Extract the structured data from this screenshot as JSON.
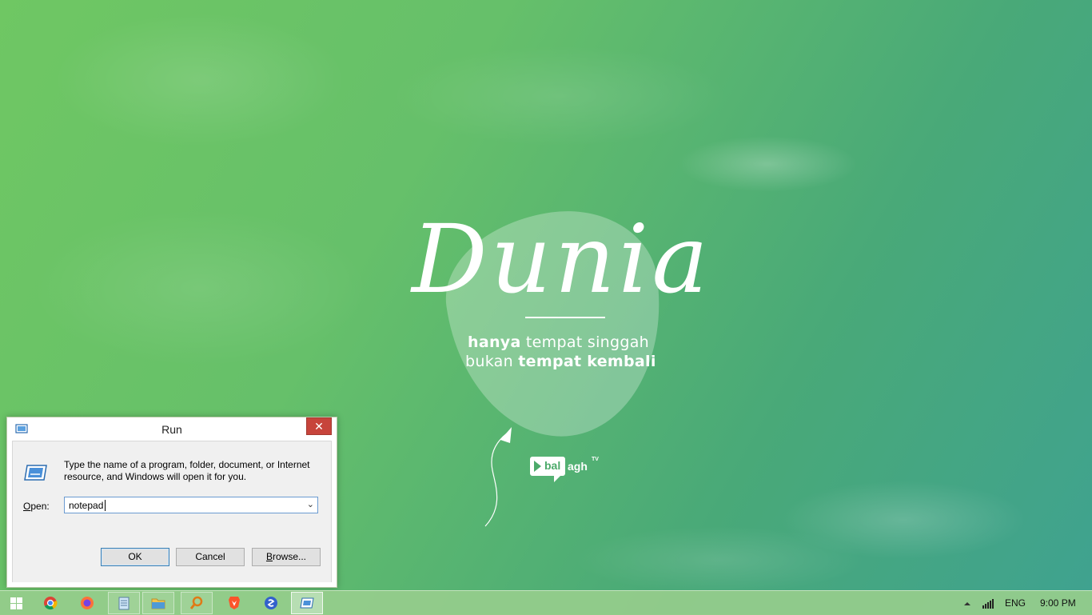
{
  "wallpaper": {
    "title": "Dunia",
    "line1_bold": "hanya",
    "line1_rest": " tempat singgah",
    "line2_start": "bukan ",
    "line2_bold": "tempat kembali",
    "brand_part1": "bal",
    "brand_part2": "agh",
    "brand_tv": "TV"
  },
  "run_dialog": {
    "title": "Run",
    "close_glyph": "✕",
    "description": "Type the name of a program, folder, document, or Internet resource, and Windows will open it for you.",
    "open_label_underlined": "O",
    "open_label_rest": "pen:",
    "open_value": "notepad",
    "ok_label": "OK",
    "cancel_label": "Cancel",
    "browse_label_underlined": "B",
    "browse_label_rest": "rowse..."
  },
  "taskbar": {
    "items": [
      "start-icon",
      "chrome-icon",
      "firefox-icon",
      "notepad-icon",
      "file-explorer-icon",
      "search-tool-icon",
      "brave-icon",
      "simplenote-icon",
      "run-icon"
    ],
    "language": "ENG",
    "time": "9:00 PM"
  },
  "colors": {
    "accent_blue": "#3c7fb1",
    "close_red": "#c7443b",
    "wallpaper_green": "#66c06a"
  }
}
